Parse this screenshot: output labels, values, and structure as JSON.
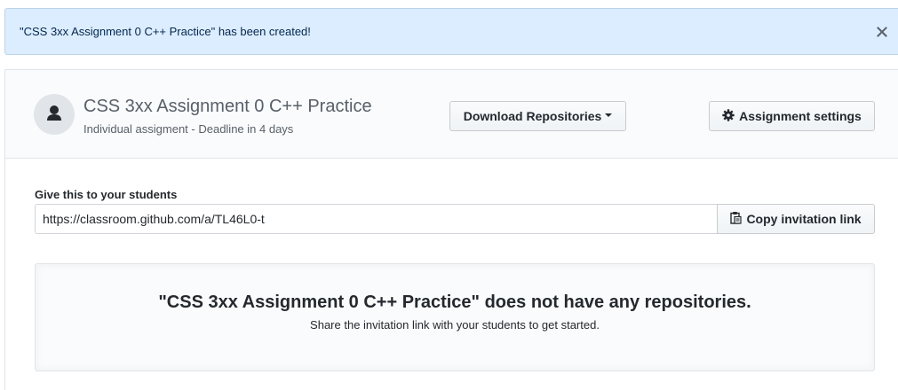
{
  "flash": {
    "message": "\"CSS 3xx Assignment 0 C++ Practice\" has been created!",
    "close_icon": "close-icon"
  },
  "assignment": {
    "title": "CSS 3xx Assignment 0 C++ Practice",
    "subtitle": "Individual assigment - Deadline in 4 days",
    "avatar_icon": "person-icon"
  },
  "actions": {
    "download_label": "Download Repositories",
    "settings_label": "Assignment settings",
    "settings_icon": "gear-icon"
  },
  "invite": {
    "label": "Give this to your students",
    "url": "https://classroom.github.com/a/TL46L0-t",
    "copy_label": "Copy invitation link",
    "copy_icon": "clipboard-icon"
  },
  "blankslate": {
    "title": "\"CSS 3xx Assignment 0 C++ Practice\" does not have any repositories.",
    "description": "Share the invitation link with your students to get started."
  },
  "colors": {
    "flash_bg": "#dbedff",
    "panel_header_bg": "#fafbfc",
    "border": "#e1e4e8"
  }
}
